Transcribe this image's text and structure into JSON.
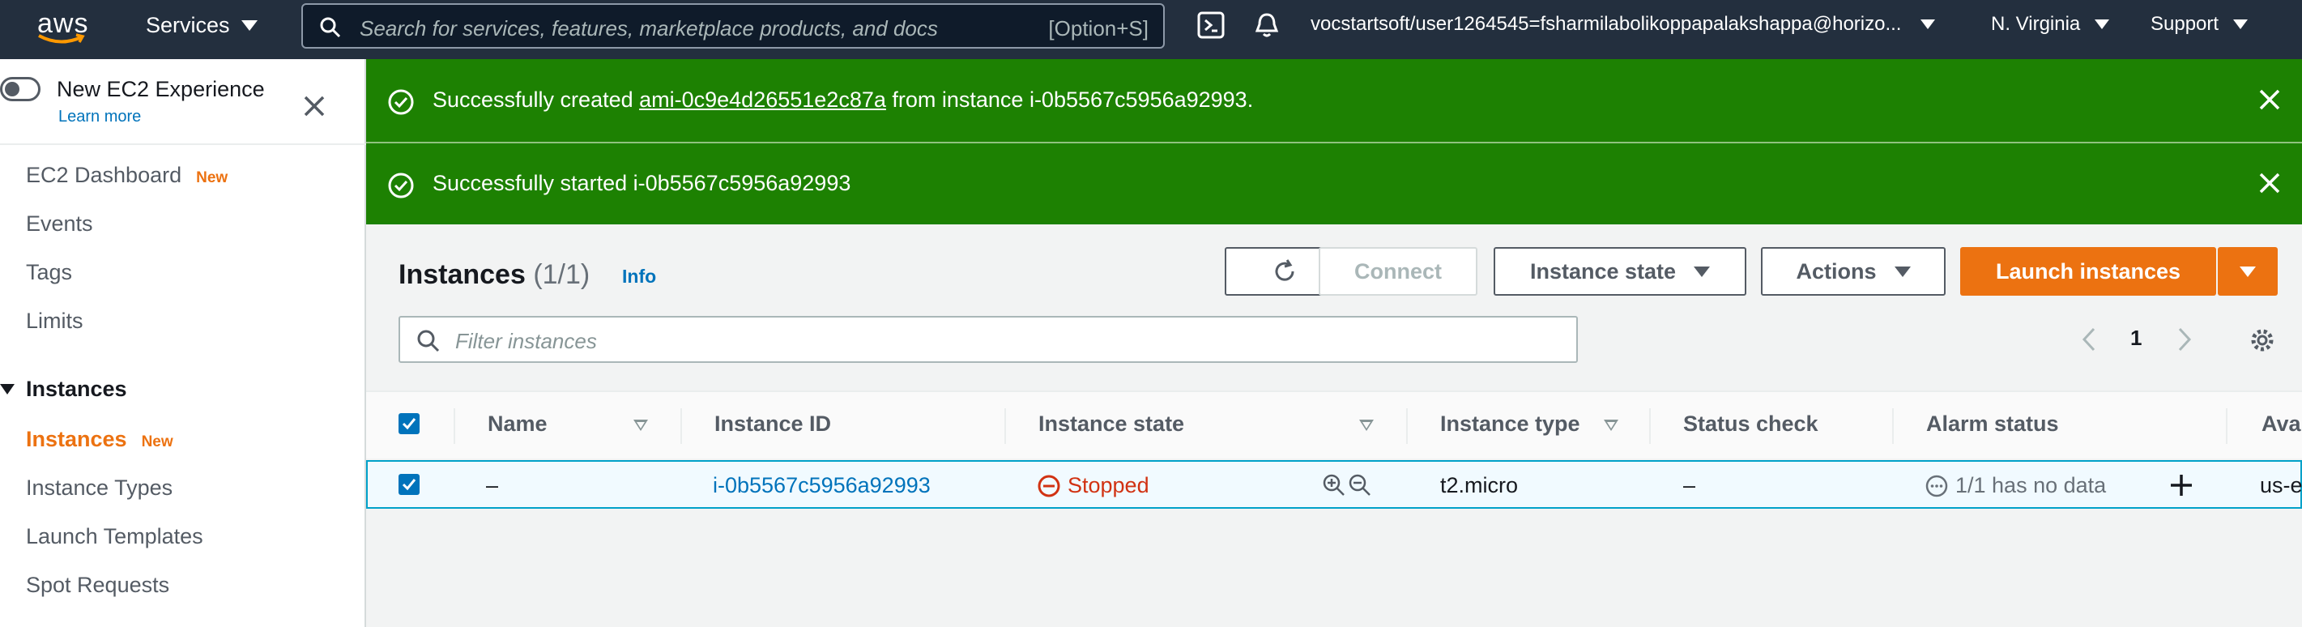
{
  "topnav": {
    "logo_text": "aws",
    "services_label": "Services",
    "search_placeholder": "Search for services, features, marketplace products, and docs",
    "search_shortcut": "[Option+S]",
    "account_label": "vocstartsoft/user1264545=fsharmilabolikoppapalakshappa@horizo...",
    "region_label": "N. Virginia",
    "support_label": "Support"
  },
  "sidebar": {
    "new_experience_label": "New EC2 Experience",
    "learn_more_label": "Learn more",
    "items": [
      {
        "label": "EC2 Dashboard",
        "badge": "New"
      },
      {
        "label": "Events"
      },
      {
        "label": "Tags"
      },
      {
        "label": "Limits"
      }
    ],
    "section_label": "Instances",
    "section_items": [
      {
        "label": "Instances",
        "badge": "New"
      },
      {
        "label": "Instance Types"
      },
      {
        "label": "Launch Templates"
      },
      {
        "label": "Spot Requests"
      }
    ]
  },
  "flash": [
    {
      "prefix": "Successfully created ",
      "link": "ami-0c9e4d26551e2c87a",
      "suffix": " from instance i-0b5567c5956a92993."
    },
    {
      "text": "Successfully started i-0b5567c5956a92993"
    }
  ],
  "main": {
    "title": "Instances",
    "count": "(1/1)",
    "info_label": "Info",
    "connect_label": "Connect",
    "instance_state_label": "Instance state",
    "actions_label": "Actions",
    "launch_label": "Launch instances",
    "filter_placeholder": "Filter instances",
    "page_number": "1"
  },
  "table": {
    "headers": [
      "Name",
      "Instance ID",
      "Instance state",
      "Instance type",
      "Status check",
      "Alarm status",
      "Avai"
    ],
    "rows": [
      {
        "name": "–",
        "instance_id": "i-0b5567c5956a92993",
        "state": "Stopped",
        "type": "t2.micro",
        "status_check": "–",
        "alarm": "1/1 has no data",
        "availability": "us-e"
      }
    ]
  },
  "colors": {
    "nav_bg": "#232f3e",
    "flash_success": "#1d8102",
    "primary": "#ec7211",
    "link": "#0073bb",
    "stopped": "#d13212"
  }
}
